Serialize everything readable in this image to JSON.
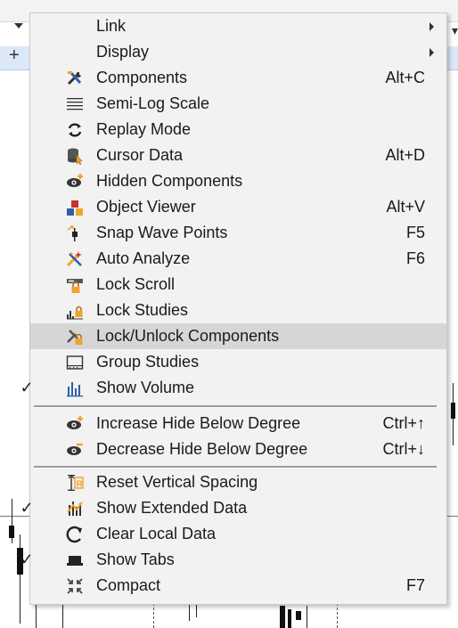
{
  "menu": {
    "items": [
      {
        "label": "Link",
        "shortcut": "",
        "submenu": true,
        "check": "",
        "icon": "none"
      },
      {
        "label": "Display",
        "shortcut": "",
        "submenu": true,
        "check": "",
        "icon": "none"
      },
      {
        "label": "Components",
        "shortcut": "Alt+C",
        "submenu": false,
        "check": "",
        "icon": "tools-icon"
      },
      {
        "label": "Semi-Log Scale",
        "shortcut": "",
        "submenu": false,
        "check": "",
        "icon": "lines-icon"
      },
      {
        "label": "Replay Mode",
        "shortcut": "",
        "submenu": false,
        "check": "",
        "icon": "replay-icon"
      },
      {
        "label": "Cursor Data",
        "shortcut": "Alt+D",
        "submenu": false,
        "check": "",
        "icon": "database-icon"
      },
      {
        "label": "Hidden Components",
        "shortcut": "",
        "submenu": false,
        "check": "",
        "icon": "eye-plus-icon"
      },
      {
        "label": "Object Viewer",
        "shortcut": "Alt+V",
        "submenu": false,
        "check": "",
        "icon": "object-blocks-icon"
      },
      {
        "label": "Snap Wave Points",
        "shortcut": "F5",
        "submenu": false,
        "check": "",
        "icon": "snap-icon"
      },
      {
        "label": "Auto Analyze",
        "shortcut": "F6",
        "submenu": false,
        "check": "",
        "icon": "auto-analyze-icon"
      },
      {
        "label": "Lock Scroll",
        "shortcut": "",
        "submenu": false,
        "check": "",
        "icon": "lock-scroll-icon"
      },
      {
        "label": "Lock Studies",
        "shortcut": "",
        "submenu": false,
        "check": "",
        "icon": "lock-studies-icon"
      },
      {
        "label": "Lock/Unlock Components",
        "shortcut": "",
        "submenu": false,
        "check": "",
        "icon": "lock-components-icon"
      },
      {
        "label": "Group Studies",
        "shortcut": "",
        "submenu": false,
        "check": "",
        "icon": "group-icon"
      },
      {
        "label": "Show Volume",
        "shortcut": "",
        "submenu": false,
        "check": "✓",
        "icon": "volume-icon"
      },
      {
        "label": "Increase Hide Below Degree",
        "shortcut": "Ctrl+↑",
        "submenu": false,
        "check": "",
        "icon": "eye-plus-icon"
      },
      {
        "label": "Decrease Hide Below Degree",
        "shortcut": "Ctrl+↓",
        "submenu": false,
        "check": "",
        "icon": "eye-minus-icon"
      },
      {
        "label": "Reset Vertical Spacing",
        "shortcut": "",
        "submenu": false,
        "check": "",
        "icon": "spacing-icon"
      },
      {
        "label": "Show Extended Data",
        "shortcut": "",
        "submenu": false,
        "check": "✓",
        "icon": "extended-data-icon"
      },
      {
        "label": "Clear Local Data",
        "shortcut": "",
        "submenu": false,
        "check": "",
        "icon": "clear-icon"
      },
      {
        "label": "Show Tabs",
        "shortcut": "",
        "submenu": false,
        "check": "✓",
        "icon": "tabs-icon"
      },
      {
        "label": "Compact",
        "shortcut": "F7",
        "submenu": false,
        "check": "",
        "icon": "compact-icon"
      }
    ],
    "highlighted": "Lock/Unlock Components"
  },
  "colors": {
    "menu_bg": "#f2f2f2",
    "highlight": "#d6d6d6",
    "text": "#1a1a1a",
    "icon_orange": "#f0a32a",
    "icon_red": "#c8322a",
    "icon_blue": "#2f5ea8",
    "separator": "#9a9a9a"
  }
}
